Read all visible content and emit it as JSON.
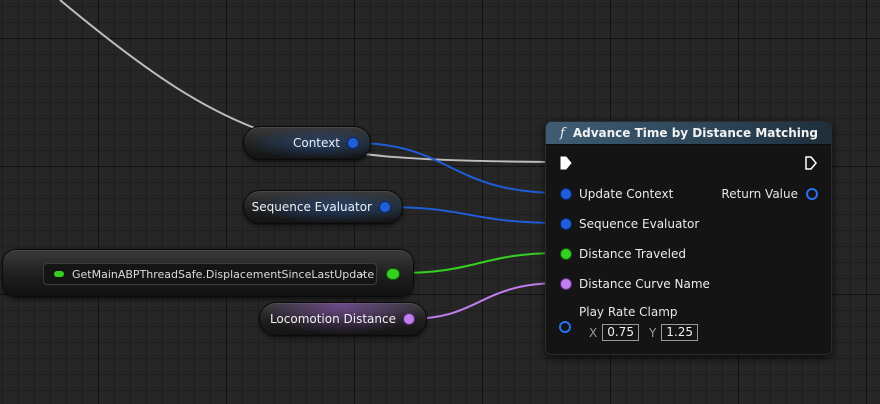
{
  "nodes": {
    "context": {
      "label": "Context"
    },
    "sequence_evaluator": {
      "label": "Sequence Evaluator"
    },
    "getter": {
      "label": "GetMainABPThreadSafe.DisplacementSinceLastUpdate"
    },
    "locomotion_distance": {
      "label": "Locomotion Distance"
    }
  },
  "function_node": {
    "title": "Advance Time by Distance Matching",
    "icon": "f",
    "inputs": {
      "update_context": "Update Context",
      "sequence_evaluator": "Sequence Evaluator",
      "distance_traveled": "Distance Traveled",
      "distance_curve_name": "Distance Curve Name",
      "play_rate_clamp": "Play Rate Clamp"
    },
    "outputs": {
      "return_value": "Return Value"
    },
    "play_rate_clamp": {
      "x_label": "X",
      "x_value": "0.75",
      "y_label": "Y",
      "y_value": "1.25"
    }
  },
  "colors": {
    "struct_pin": "#1f5ed8",
    "float_pin": "#35d021",
    "name_pin": "#c07ef0",
    "exec_wire": "#bdbdbd",
    "header": "#3e5d74"
  }
}
